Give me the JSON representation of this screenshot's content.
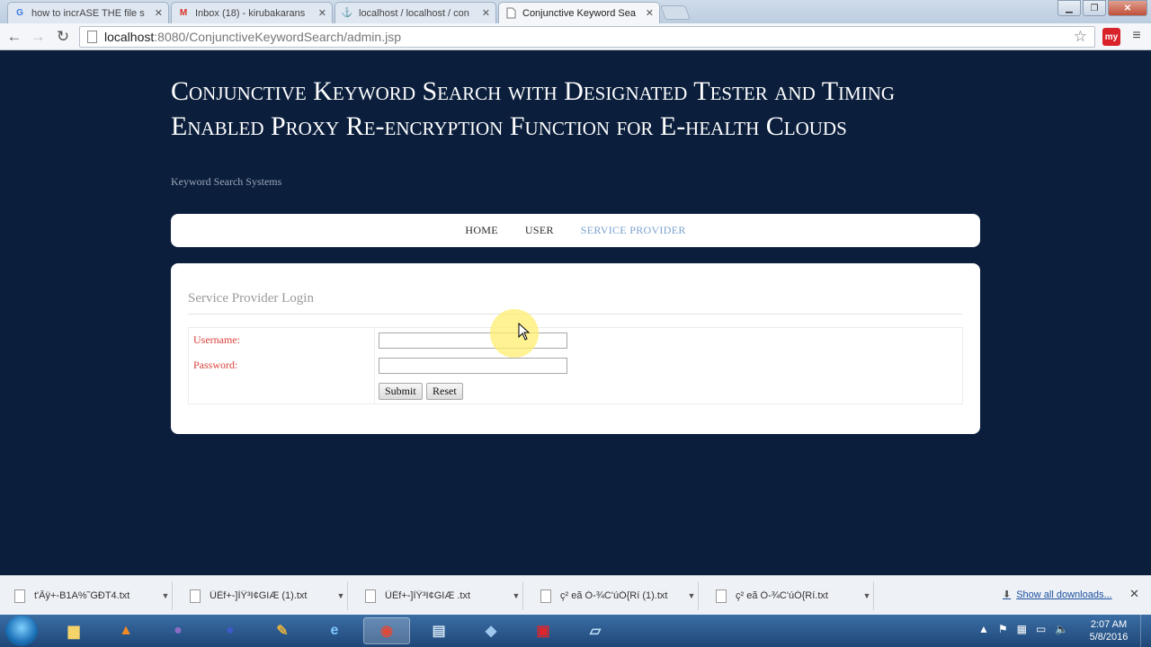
{
  "browser": {
    "tabs": [
      {
        "label": "how to incrASE THE file s",
        "favicon": "google-icon",
        "active": false
      },
      {
        "label": "Inbox (18) - kirubakarans",
        "favicon": "gmail-icon",
        "active": false
      },
      {
        "label": "localhost / localhost / con",
        "favicon": "phpmyadmin-icon",
        "active": false
      },
      {
        "label": "Conjunctive Keyword Sea",
        "favicon": "page-icon",
        "active": true
      }
    ],
    "url_host": "localhost",
    "url_rest": ":8080/ConjunctiveKeywordSearch/admin.jsp",
    "extension_label": "my"
  },
  "site": {
    "title": "Conjunctive Keyword Search with Designated Tester and Timing Enabled Proxy Re-encryption Function for E-health Clouds",
    "subtitle": "Keyword Search Systems",
    "nav": [
      {
        "label": "HOME",
        "active": false
      },
      {
        "label": "USER",
        "active": false
      },
      {
        "label": "SERVICE PROVIDER",
        "active": true
      }
    ]
  },
  "login": {
    "heading": "Service Provider Login",
    "username_label": "Username:",
    "password_label": "Password:",
    "username_value": "",
    "password_value": "",
    "submit_label": "Submit",
    "reset_label": "Reset"
  },
  "downloads": {
    "items": [
      "t'Ãÿ+-B1A%˜GÐT4.txt",
      "ÜÉf+-]ÌŸ³I¢GIÆ (1).txt",
      "ÜÉf+-]ÌŸ³I¢GIÆ .txt",
      "ç² eã Ó-¾C'úÓ{Rí (1).txt",
      "ç² eã Ó-¾C'úÓ{Rí.txt"
    ],
    "show_all_label": "Show all downloads..."
  },
  "taskbar": {
    "clock_time": "2:07 AM",
    "clock_date": "5/8/2016",
    "apps": [
      "explorer-icon",
      "vlc-icon",
      "eclipse-icon",
      "eclipse-blue-icon",
      "tools-icon",
      "ie-icon",
      "chrome-icon",
      "db-icon",
      "virtualbox-icon",
      "acrobat-icon",
      "notepad-icon"
    ]
  },
  "colors": {
    "page_background": "#0b1e3c",
    "nav_active": "#7aa2cf",
    "label_red": "#d9413b"
  }
}
